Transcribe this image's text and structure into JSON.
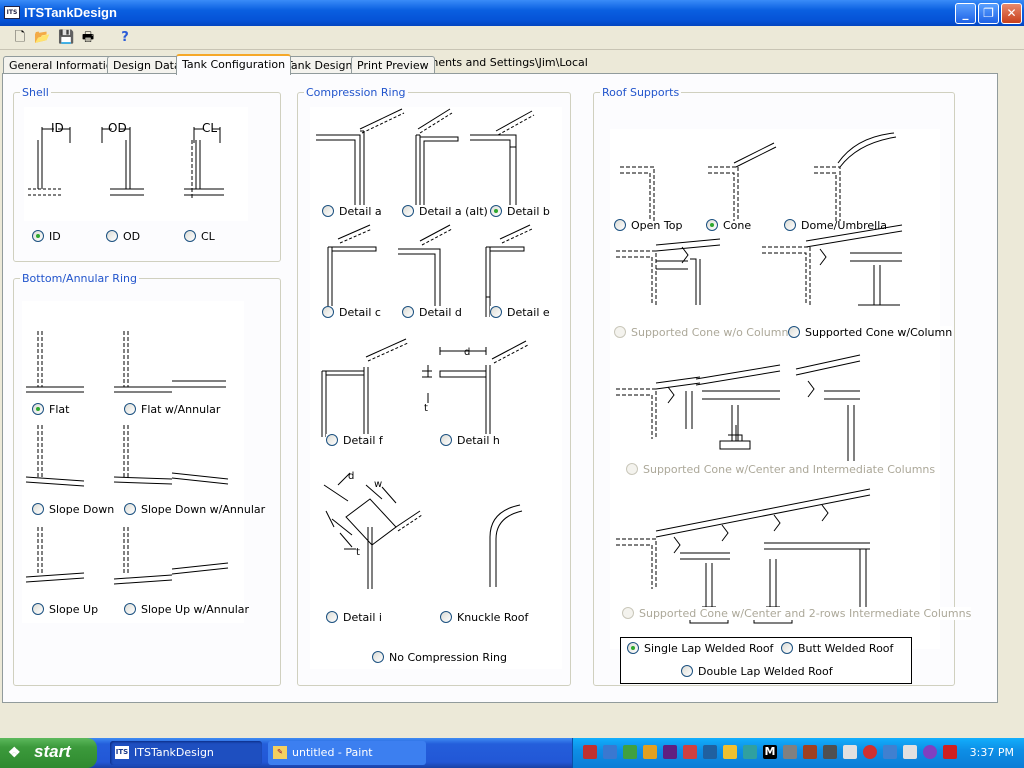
{
  "window": {
    "title": "ITSTankDesign",
    "open_file": "Currently open file = C:\\Documents and Settings\\Jim\\Local"
  },
  "tabs": [
    "General Information",
    "Design Data",
    "Tank Configuration",
    "Tank Design",
    "Print Preview"
  ],
  "active_tab": "Tank Configuration",
  "shell": {
    "label": "Shell",
    "options": [
      "ID",
      "OD",
      "CL"
    ],
    "pic_labels": [
      "ID",
      "OD",
      "CL"
    ],
    "selected": "ID"
  },
  "bottom": {
    "label": "Bottom/Annular Ring",
    "options": [
      "Flat",
      "Flat w/Annular",
      "Slope Down",
      "Slope Down w/Annular",
      "Slope Up",
      "Slope Up w/Annular"
    ],
    "selected": "Flat"
  },
  "compression": {
    "label": "Compression Ring",
    "options": [
      "Detail a",
      "Detail a (alt)",
      "Detail b",
      "Detail c",
      "Detail d",
      "Detail e",
      "Detail f",
      "Detail h",
      "Detail i",
      "Knuckle Roof",
      "No Compression Ring"
    ],
    "selected": "Detail b",
    "dim_labels": [
      "d",
      "t",
      "d",
      "w",
      "t"
    ]
  },
  "roof": {
    "label": "Roof Supports",
    "options": [
      "Open Top",
      "Cone",
      "Dome/Umbrella",
      "Supported Cone w/o Column",
      "Supported Cone w/Column",
      "Supported Cone w/Center and Intermediate Columns",
      "Supported Cone w/Center and 2-rows Intermediate Columns"
    ],
    "selected": "Cone",
    "disabled": [
      "Supported Cone w/o Column",
      "Supported Cone w/Center and Intermediate Columns",
      "Supported Cone w/Center and 2-rows Intermediate Columns"
    ]
  },
  "deck": {
    "options": [
      "Single Lap Welded Roof",
      "Butt Welded Roof",
      "Double Lap Welded Roof"
    ],
    "selected": "Single Lap Welded Roof"
  },
  "taskbar": {
    "start": "start",
    "tasks": [
      "ITSTankDesign",
      "untitled - Paint"
    ],
    "clock": "3:37 PM"
  },
  "colors": {
    "titlebar": "#0552d6",
    "taskbar": "#245edb",
    "group_label": "#2255cc",
    "tab_highlight": "#f5a829",
    "start": "#3c9a3c"
  }
}
